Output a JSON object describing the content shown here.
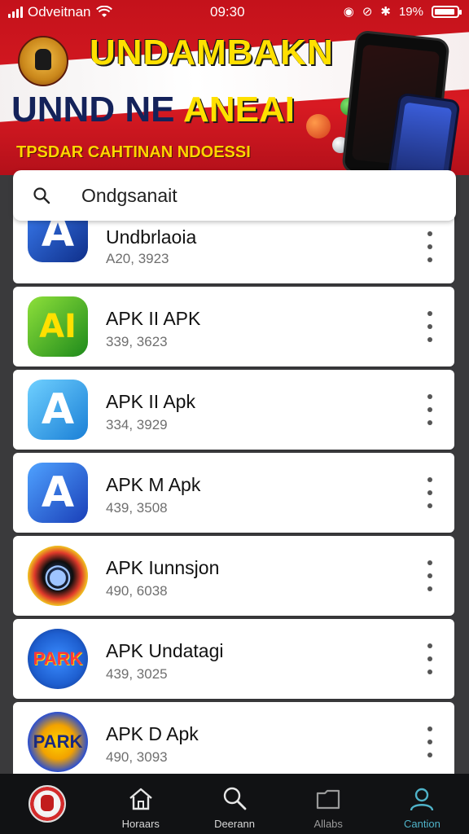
{
  "status_bar": {
    "carrier": "Odveitnan",
    "time": "09:30",
    "battery_percent": "19%"
  },
  "banner": {
    "title_line1": "UNDAMBAKN",
    "title_line2_part1": "UNND NE",
    "title_line2_part2": "ANEAI",
    "subtitle": "TPSDAR CAHTINAN NDOESSI"
  },
  "search": {
    "value": "Ondgsanait"
  },
  "apps": [
    {
      "name": "Undbrlaoia",
      "sub": "A20, 3923",
      "glyph": "A",
      "icon_color": "#1b56c9"
    },
    {
      "name": "APK II APK",
      "sub": "339, 3623",
      "glyph": "AI",
      "icon_color": "#2fa72b"
    },
    {
      "name": "APK II Apk",
      "sub": "334, 3929",
      "glyph": "A",
      "icon_color": "#2a9be0"
    },
    {
      "name": "APK M Apk",
      "sub": "439, 3508",
      "glyph": "A",
      "icon_color": "#2367d8"
    },
    {
      "name": "APK Iunnsjon",
      "sub": "490, 6038",
      "glyph": "◉",
      "icon_color": "#1a1a1a"
    },
    {
      "name": "APK Undatagi",
      "sub": "439, 3025",
      "glyph": "PARK",
      "icon_color": "#1e6fe0"
    },
    {
      "name": "APK D Apk",
      "sub": "490, 3093",
      "glyph": "PARK",
      "icon_color": "#2b4fd0"
    }
  ],
  "bottom_nav": [
    {
      "label": "",
      "icon": "flag-emblem-avatar"
    },
    {
      "label": "Horaars",
      "icon": "home-icon"
    },
    {
      "label": "Deerann",
      "icon": "search-icon"
    },
    {
      "label": "Allabs",
      "icon": "folder-icon"
    },
    {
      "label": "Cantion",
      "icon": "profile-icon"
    }
  ],
  "colors": {
    "banner_red": "#d81a22",
    "banner_yellow": "#ffe000",
    "nav_active": "#4fb3c9",
    "nav_bg": "#111214"
  }
}
